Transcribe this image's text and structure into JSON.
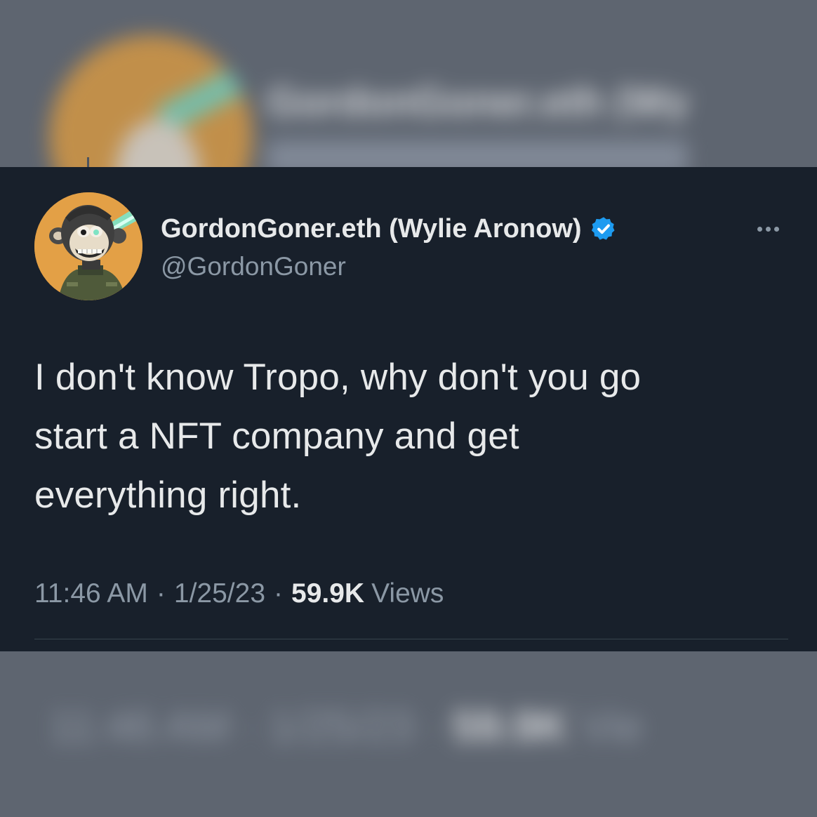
{
  "tweet": {
    "author_name": "GordonGoner.eth (Wylie Aronow)",
    "author_handle": "@GordonGoner",
    "verified": true,
    "text_lines": [
      "I don't know Tropo, why don't you go",
      "start a NFT company and get",
      "everything right."
    ],
    "time": "11:46 AM",
    "separator": "·",
    "date": "1/25/23",
    "views_count": "59.9K",
    "views_label": "Views"
  },
  "backdrop": {
    "name_fragment": "GordonGoner.eth (Wy",
    "time": "11:46 AM",
    "date": "1/25/23",
    "views_count": "59.9K",
    "views_label": "Vie"
  },
  "icons": {
    "verified": "verified-badge-icon",
    "more": "more-options-icon",
    "avatar": "bored-ape-avatar"
  },
  "colors": {
    "card_background": "#18202b",
    "primary_text": "#e7e9ea",
    "secondary_text": "#8b98a5",
    "verified_blue": "#1d9bf0",
    "divider": "#38444d"
  }
}
